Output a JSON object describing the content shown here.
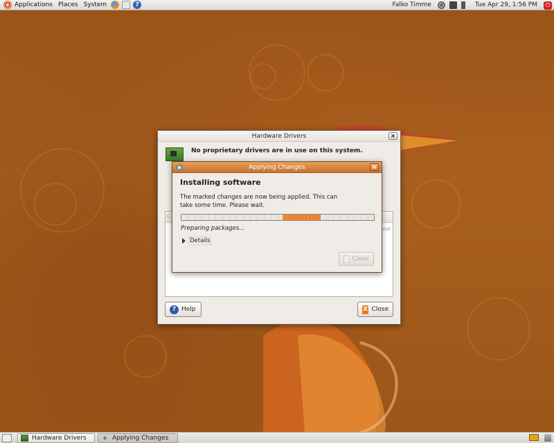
{
  "top_panel": {
    "menus": [
      "Applications",
      "Places",
      "System"
    ],
    "user": "Falko Timme",
    "clock": "Tue Apr 29,  1:56 PM",
    "help_icon_glyph": "?",
    "shutdown_glyph": "⏻"
  },
  "hardware_window": {
    "title": "Hardware Drivers",
    "message": "No proprietary drivers are in use on this system.",
    "list_col1": "C",
    "list_col2": "use",
    "help_button": "Help",
    "close_button": "Close",
    "help_glyph": "?",
    "close_glyph": "X",
    "close_x": "×"
  },
  "apply_window": {
    "title": "Applying Changes",
    "heading": "Installing software",
    "description": "The marked changes are now being applied. This can take some time. Please wait.",
    "status": "Preparing packages...",
    "details": "Details",
    "close_button": "Close",
    "close_x": "×",
    "progress_mode": "pulsing"
  },
  "bottom_panel": {
    "tasks": [
      {
        "label": "Hardware Drivers",
        "active": false
      },
      {
        "label": "Applying Changes",
        "active": true
      }
    ]
  },
  "colors": {
    "wallpaper": "#a25a1b",
    "accent_title": "#c6712e",
    "progress": "#f08a3a"
  }
}
